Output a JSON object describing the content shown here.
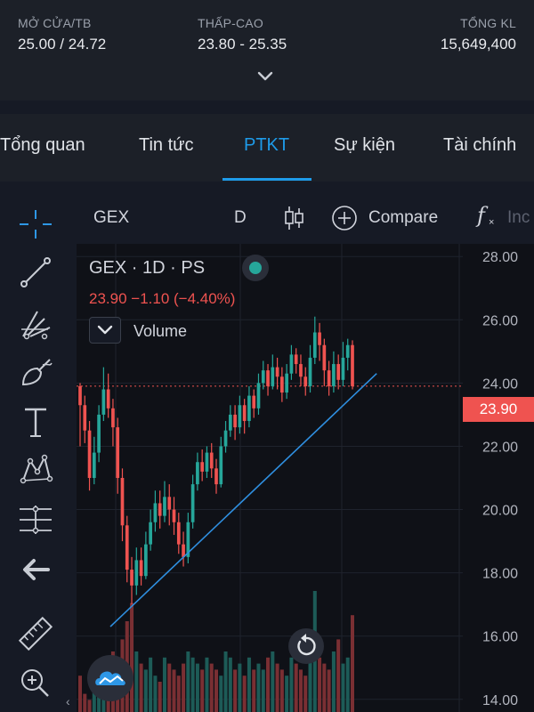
{
  "stats": {
    "open_label": "MỞ CỬA/TB",
    "open_value": "25.00 / 24.72",
    "range_label": "THẤP-CAO",
    "range_value": "23.80 - 25.35",
    "volume_label": "TỔNG KL",
    "volume_value": "15,649,400"
  },
  "tabs": [
    {
      "label": "Tổng quan",
      "active": false
    },
    {
      "label": "Tin tức",
      "active": false
    },
    {
      "label": "PTKT",
      "active": true
    },
    {
      "label": "Sự kiện",
      "active": false
    },
    {
      "label": "Tài chính",
      "active": false
    }
  ],
  "toolbar": {
    "symbol": "GEX",
    "interval": "D",
    "compare_label": "Compare",
    "indicators_partial": "Inc"
  },
  "legend": {
    "title": "GEX · 1D · PS",
    "price_line": "23.90  −1.10 (−4.40%)",
    "volume_label": "Volume"
  },
  "price_axis": {
    "ticks": [
      "28.00",
      "26.00",
      "24.00",
      "22.00",
      "20.00",
      "18.00",
      "16.00",
      "14.00"
    ],
    "last_price": "23.90"
  },
  "colors": {
    "up": "#26a69a",
    "down": "#ef5350",
    "accent": "#1e9be9",
    "trendline": "#2f8fe0"
  },
  "sidebar_icons": [
    "crosshair-icon",
    "trend-line-icon",
    "pitchfork-icon",
    "brush-icon",
    "text-icon",
    "pattern-icon",
    "measure-icon",
    "back-arrow-icon",
    "ruler-icon",
    "zoom-in-icon"
  ],
  "chart_data": {
    "type": "candlestick",
    "ylim": [
      13.6,
      28.4
    ],
    "last_price": 23.9,
    "candles": [
      [
        23.9,
        23.3,
        24.0,
        22.0
      ],
      [
        23.3,
        22.5,
        23.6,
        22.1
      ],
      [
        22.5,
        21.0,
        22.8,
        20.6
      ],
      [
        21.0,
        21.8,
        22.3,
        20.8
      ],
      [
        21.8,
        23.0,
        23.3,
        21.5
      ],
      [
        23.0,
        23.8,
        24.5,
        22.8
      ],
      [
        23.8,
        23.2,
        24.3,
        22.9
      ],
      [
        23.2,
        22.6,
        23.5,
        22.0
      ],
      [
        22.6,
        21.0,
        22.9,
        20.5
      ],
      [
        21.0,
        19.5,
        21.3,
        19.0
      ],
      [
        19.5,
        18.1,
        19.8,
        17.7
      ],
      [
        18.1,
        17.6,
        18.5,
        17.0
      ],
      [
        17.6,
        18.4,
        18.8,
        17.3
      ],
      [
        18.4,
        17.9,
        18.8,
        17.6
      ],
      [
        17.9,
        18.9,
        19.3,
        17.8
      ],
      [
        18.9,
        19.6,
        20.0,
        18.7
      ],
      [
        19.6,
        20.2,
        20.6,
        19.3
      ],
      [
        20.2,
        19.8,
        20.6,
        19.4
      ],
      [
        19.8,
        20.4,
        20.9,
        19.6
      ],
      [
        20.4,
        20.0,
        20.8,
        19.5
      ],
      [
        20.0,
        19.6,
        20.4,
        19.2
      ],
      [
        19.6,
        18.9,
        19.9,
        18.6
      ],
      [
        18.9,
        18.5,
        19.3,
        18.2
      ],
      [
        18.5,
        19.6,
        19.9,
        18.3
      ],
      [
        19.6,
        20.8,
        21.1,
        19.4
      ],
      [
        20.8,
        21.5,
        21.8,
        20.6
      ],
      [
        21.5,
        21.2,
        21.9,
        20.9
      ],
      [
        21.2,
        21.8,
        22.0,
        21.0
      ],
      [
        21.8,
        21.3,
        22.1,
        21.0
      ],
      [
        21.3,
        20.8,
        21.6,
        20.5
      ],
      [
        20.8,
        22.0,
        22.3,
        20.7
      ],
      [
        22.0,
        22.5,
        22.8,
        21.8
      ],
      [
        22.5,
        23.0,
        23.3,
        22.3
      ],
      [
        23.0,
        22.6,
        23.3,
        22.2
      ],
      [
        22.6,
        23.3,
        23.6,
        22.4
      ],
      [
        23.3,
        22.8,
        23.5,
        22.4
      ],
      [
        22.8,
        23.6,
        23.9,
        22.6
      ],
      [
        23.6,
        23.2,
        23.8,
        22.9
      ],
      [
        23.2,
        24.0,
        24.3,
        23.0
      ],
      [
        24.0,
        24.4,
        24.7,
        23.8
      ],
      [
        24.4,
        23.9,
        24.6,
        23.6
      ],
      [
        23.9,
        24.5,
        24.9,
        23.8
      ],
      [
        24.5,
        24.2,
        24.8,
        23.8
      ],
      [
        24.2,
        23.7,
        24.5,
        23.4
      ],
      [
        23.7,
        24.3,
        24.6,
        23.5
      ],
      [
        24.3,
        24.9,
        25.2,
        24.1
      ],
      [
        24.9,
        24.6,
        25.1,
        24.3
      ],
      [
        24.6,
        24.2,
        24.9,
        23.9
      ],
      [
        24.2,
        23.9,
        24.5,
        23.6
      ],
      [
        23.9,
        24.8,
        25.2,
        23.7
      ],
      [
        24.8,
        25.6,
        26.1,
        24.6
      ],
      [
        25.6,
        25.2,
        25.9,
        24.7
      ],
      [
        25.2,
        24.4,
        25.4,
        23.9
      ],
      [
        24.4,
        23.9,
        24.7,
        23.6
      ],
      [
        23.9,
        24.6,
        25.0,
        23.7
      ],
      [
        24.6,
        24.1,
        24.9,
        23.8
      ],
      [
        24.1,
        24.8,
        25.3,
        23.9
      ],
      [
        24.8,
        25.2,
        25.4,
        24.4
      ],
      [
        25.2,
        23.9,
        25.35,
        23.8
      ]
    ],
    "volume": [
      6,
      3,
      2,
      5,
      7,
      9,
      4,
      10,
      8,
      12,
      15,
      18,
      10,
      8,
      7,
      9,
      6,
      5,
      9,
      8,
      7,
      6,
      8,
      10,
      9,
      8,
      7,
      9,
      8,
      7,
      6,
      10,
      9,
      7,
      8,
      6,
      9,
      7,
      8,
      7,
      9,
      10,
      8,
      7,
      6,
      9,
      8,
      7,
      6,
      12,
      20,
      9,
      8,
      7,
      10,
      12,
      8,
      9,
      16
    ],
    "trendline": {
      "start": [
        16.3,
        0.1
      ],
      "end": [
        24.3,
        0.98
      ]
    }
  }
}
